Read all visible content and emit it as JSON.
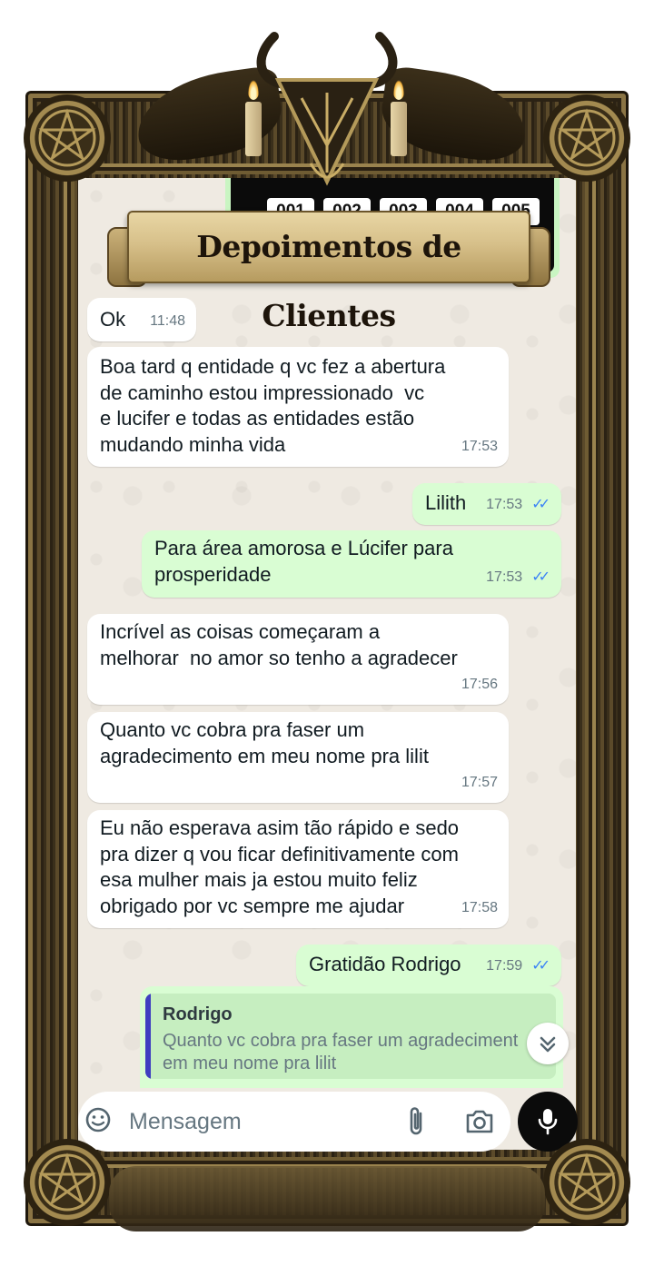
{
  "banner": {
    "title": "Depoimentos de Clientes"
  },
  "top_image": {
    "numbers": [
      "001",
      "002",
      "003",
      "004",
      "005"
    ]
  },
  "messages": [
    {
      "direction": "in",
      "text": "Ok",
      "time": "11:48"
    },
    {
      "direction": "in",
      "text": "Boa tard q entidade q vc fez a abertura\nde caminho estou impressionado  vc\ne lucifer e todas as entidades estão\nmudando minha vida",
      "time": "17:53"
    },
    {
      "direction": "out",
      "text": "Lilith",
      "time": "17:53",
      "read": true
    },
    {
      "direction": "out",
      "text": "Para área amorosa e Lúcifer para\nprosperidade",
      "time": "17:53",
      "read": true
    },
    {
      "direction": "in",
      "text": "Incrível as coisas começaram a\nmelhorar  no amor so tenho a agradecer",
      "time": "17:56"
    },
    {
      "direction": "in",
      "text": "Quanto vc cobra pra faser um\nagradecimento em meu nome pra lilit",
      "time": "17:57"
    },
    {
      "direction": "in",
      "text": "Eu não esperava asim tão rápido e sedo\npra dizer q vou ficar definitivamente com\nesa mulher mais ja estou muito feliz\nobrigado por vc sempre me ajudar",
      "time": "17:58"
    },
    {
      "direction": "out",
      "text": "Gratidão Rodrigo",
      "time": "17:59",
      "read": true
    }
  ],
  "reply": {
    "name": "Rodrigo",
    "line1": "Quanto vc cobra pra faser um agradeciment",
    "line2": "em meu nome pra lilit"
  },
  "composer": {
    "placeholder": "Mensagem"
  },
  "icons": {
    "emoji": "sticker-smiley-icon",
    "attach": "paperclip-icon",
    "camera": "camera-icon",
    "mic": "microphone-icon",
    "scroll": "chevron-double-down-icon",
    "read_ticks": "double-check-icon"
  },
  "colors": {
    "chat_background": "#efeae2",
    "outgoing_bubble": "#d9fdd3",
    "incoming_bubble": "#ffffff",
    "read_ticks": "#3b82f6",
    "reply_bar": "#3f3fc0",
    "frame_gold": "#a38a50"
  }
}
